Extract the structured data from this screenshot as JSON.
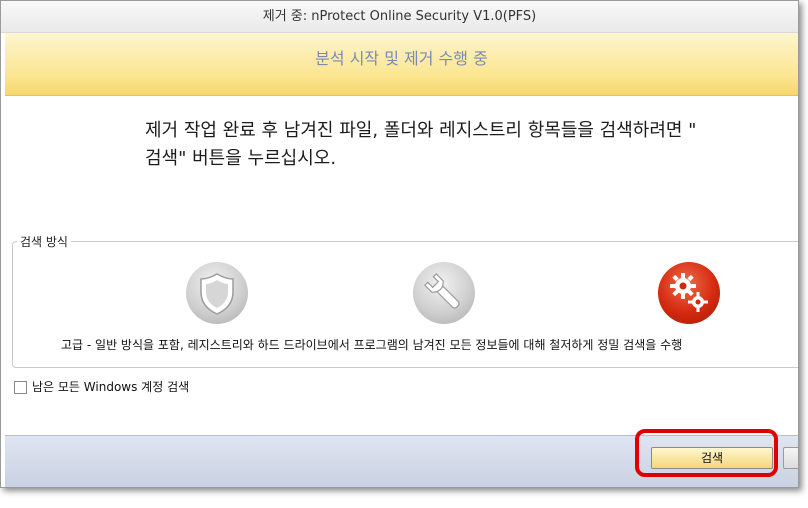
{
  "window": {
    "title": "제거 중: nProtect Online Security V1.0(PFS)"
  },
  "banner": {
    "title": "분석 시작 및 제거 수행 중"
  },
  "message": {
    "line1": "제거 작업 완료 후 남겨진 파일, 폴더와 레지스트리 항목들을 검색하려면 \"",
    "line2": "검색\" 버튼을 누르십시오."
  },
  "search_method": {
    "legend": "검색 방식",
    "options": [
      {
        "icon": "shield-icon",
        "color": "#bdbdbd"
      },
      {
        "icon": "wrench-icon",
        "color": "#bdbdbd"
      },
      {
        "icon": "gears-icon",
        "color": "#cc2a0e"
      }
    ],
    "description": "고급 - 일반 방식을 포함, 레지스트리와 하드 드라이브에서 프로그램의 남겨진 모든 정보들에 대해 철저하게 정밀 검색을 수행"
  },
  "checkbox": {
    "label": "남은 모든 Windows 계정 검색",
    "checked": false
  },
  "footer": {
    "search_button_label": "검색"
  },
  "colors": {
    "banner_gold": "#f6d76e",
    "highlight_red": "#e10000"
  }
}
